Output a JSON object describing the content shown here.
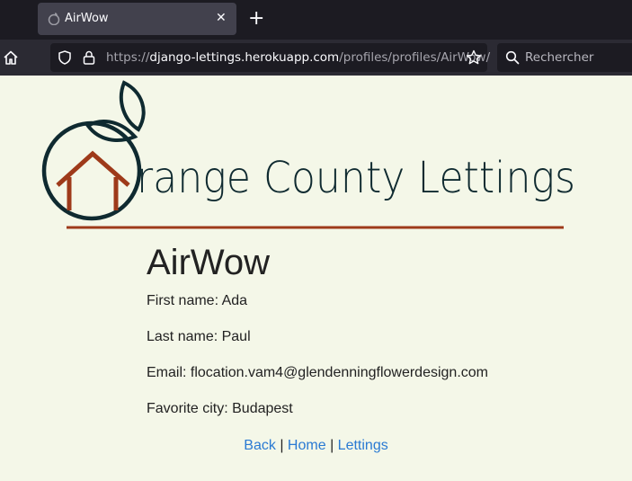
{
  "browser": {
    "tab_title": "AirWow",
    "tab_close": "✕",
    "new_tab": "+",
    "url_host_prefix": "https://",
    "url_host": "django-lettings.herokuapp.com",
    "url_path": "/profiles/profiles/AirWow/",
    "search_placeholder": "Rechercher"
  },
  "logo": {
    "text": "range County Lettings",
    "colors": {
      "dark": "#0f2a30",
      "house": "#9e3a1a",
      "rule": "#9e3a1a"
    }
  },
  "profile": {
    "title": "AirWow",
    "first_name": "First name: Ada",
    "last_name": "Last name: Paul",
    "email": "Email: flocation.vam4@glendenningflowerdesign.com",
    "favorite_city": "Favorite city: Budapest"
  },
  "links": {
    "back": "Back",
    "home": "Home",
    "lettings": "Lettings",
    "separator": "|"
  }
}
